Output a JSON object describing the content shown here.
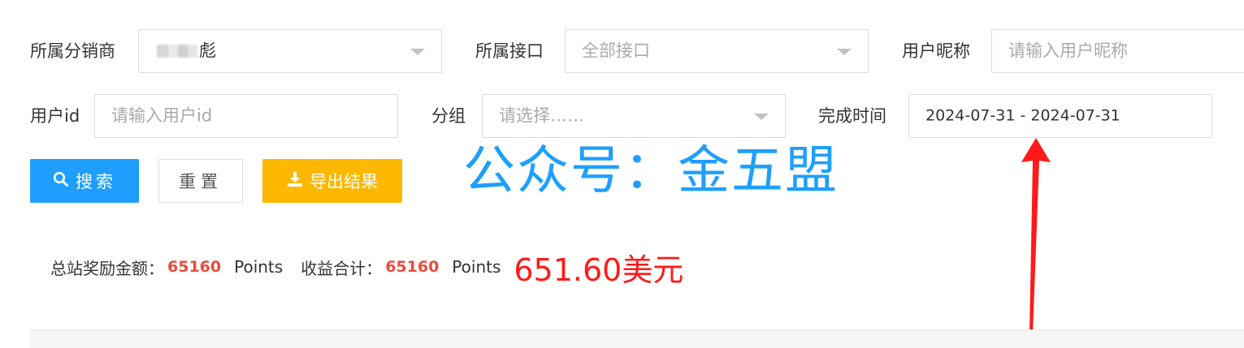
{
  "filters": {
    "distributor": {
      "label": "所属分销商",
      "value": "彪"
    },
    "interface": {
      "label": "所属接口",
      "value": "全部接口"
    },
    "nickname": {
      "label": "用户昵称",
      "placeholder": "请输入用户昵称"
    },
    "user_id": {
      "label": "用户id",
      "placeholder": "请输入用户id"
    },
    "group": {
      "label": "分组",
      "placeholder": "请选择……"
    },
    "completion_time": {
      "label": "完成时间",
      "value": "2024-07-31 - 2024-07-31"
    }
  },
  "buttons": {
    "search": "搜索",
    "reset": "重置",
    "export": "导出结果"
  },
  "icons": {
    "search": "search-icon",
    "download": "download-icon",
    "dropdown": "chevron-down-icon"
  },
  "watermark": "公众号：金五盟",
  "summary": {
    "reward_label": "总站奖励金额：",
    "reward_value": "65160",
    "reward_unit": "Points",
    "income_label": "收益合计：",
    "income_value": "65160",
    "income_unit": "Points",
    "usd_amount": "651.60美元"
  },
  "colors": {
    "primary": "#1e9fff",
    "warning": "#ffb800",
    "highlight_number": "#e84c3d",
    "annotation_red": "#ff1a1a"
  }
}
